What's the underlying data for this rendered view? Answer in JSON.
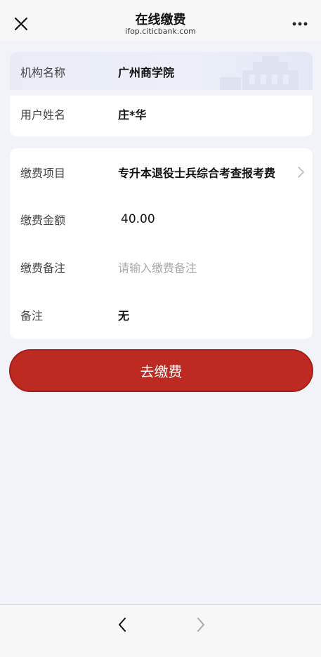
{
  "header": {
    "title": "在线缴费",
    "subtitle": "ifop.citicbank.com",
    "close_icon": "close-icon",
    "more_icon": "more-icon"
  },
  "institution": {
    "label": "机构名称",
    "value": "广州商学院"
  },
  "user": {
    "label": "用户姓名",
    "value": "庄*华"
  },
  "payment": {
    "item_label": "缴费项目",
    "item_value": "专升本退役士兵综合考查报考费",
    "amount_label": "缴费金额",
    "amount_value": "40.00",
    "note_label": "缴费备注",
    "note_placeholder": "请输入缴费备注",
    "remark_label": "备注",
    "remark_value": "无"
  },
  "action": {
    "pay_label": "去缴费"
  },
  "colors": {
    "accent": "#bc2a22",
    "background": "#f2f3f8"
  }
}
